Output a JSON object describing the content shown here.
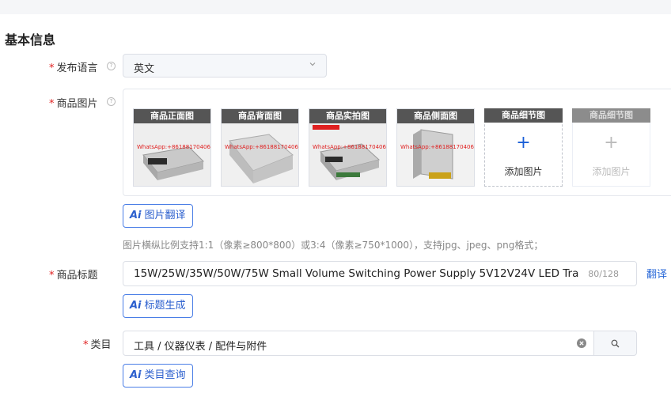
{
  "section": {
    "title": "基本信息"
  },
  "language": {
    "label": "发布语言",
    "value": "英文"
  },
  "images": {
    "label": "商品图片",
    "thumbnails": [
      {
        "caption": "商品正面图",
        "watermark": "WhatsApp:+8618817040688"
      },
      {
        "caption": "商品背面图",
        "watermark": "WhatsApp:+8618817040688"
      },
      {
        "caption": "商品实拍图",
        "watermark": "WhatsApp:+8618817040688"
      },
      {
        "caption": "商品侧面图",
        "watermark": "WhatsApp:+8618817040688"
      }
    ],
    "add_slots": [
      {
        "caption": "商品细节图",
        "label": "添加图片",
        "enabled": true
      },
      {
        "caption": "商品细节图",
        "label": "添加图片",
        "enabled": false
      }
    ],
    "translate_button": "图片翻译",
    "hint": "图片横纵比例支持1:1（像素≥800*800）或3:4（像素≥750*1000），支持jpg、jpeg、png格式；"
  },
  "title_field": {
    "label": "商品标题",
    "value": "15W/25W/35W/50W/75W Small Volume Switching Power Supply 5V12V24V LED Tra",
    "count": "80/128",
    "translate_link": "翻译",
    "generate_button": "标题生成"
  },
  "category": {
    "label": "类目",
    "value": "工具 / 仪器仪表 / 配件与附件",
    "query_button": "类目查询"
  },
  "ai_badge": "Ai",
  "icons": {
    "help": "help-circle-icon",
    "chevron": "chevron-down-icon",
    "plus": "plus-icon",
    "clear": "clear-circle-icon",
    "search": "search-icon"
  },
  "colors": {
    "accent": "#2b5fce",
    "required": "#e02020",
    "caption_bg": "#555555"
  }
}
